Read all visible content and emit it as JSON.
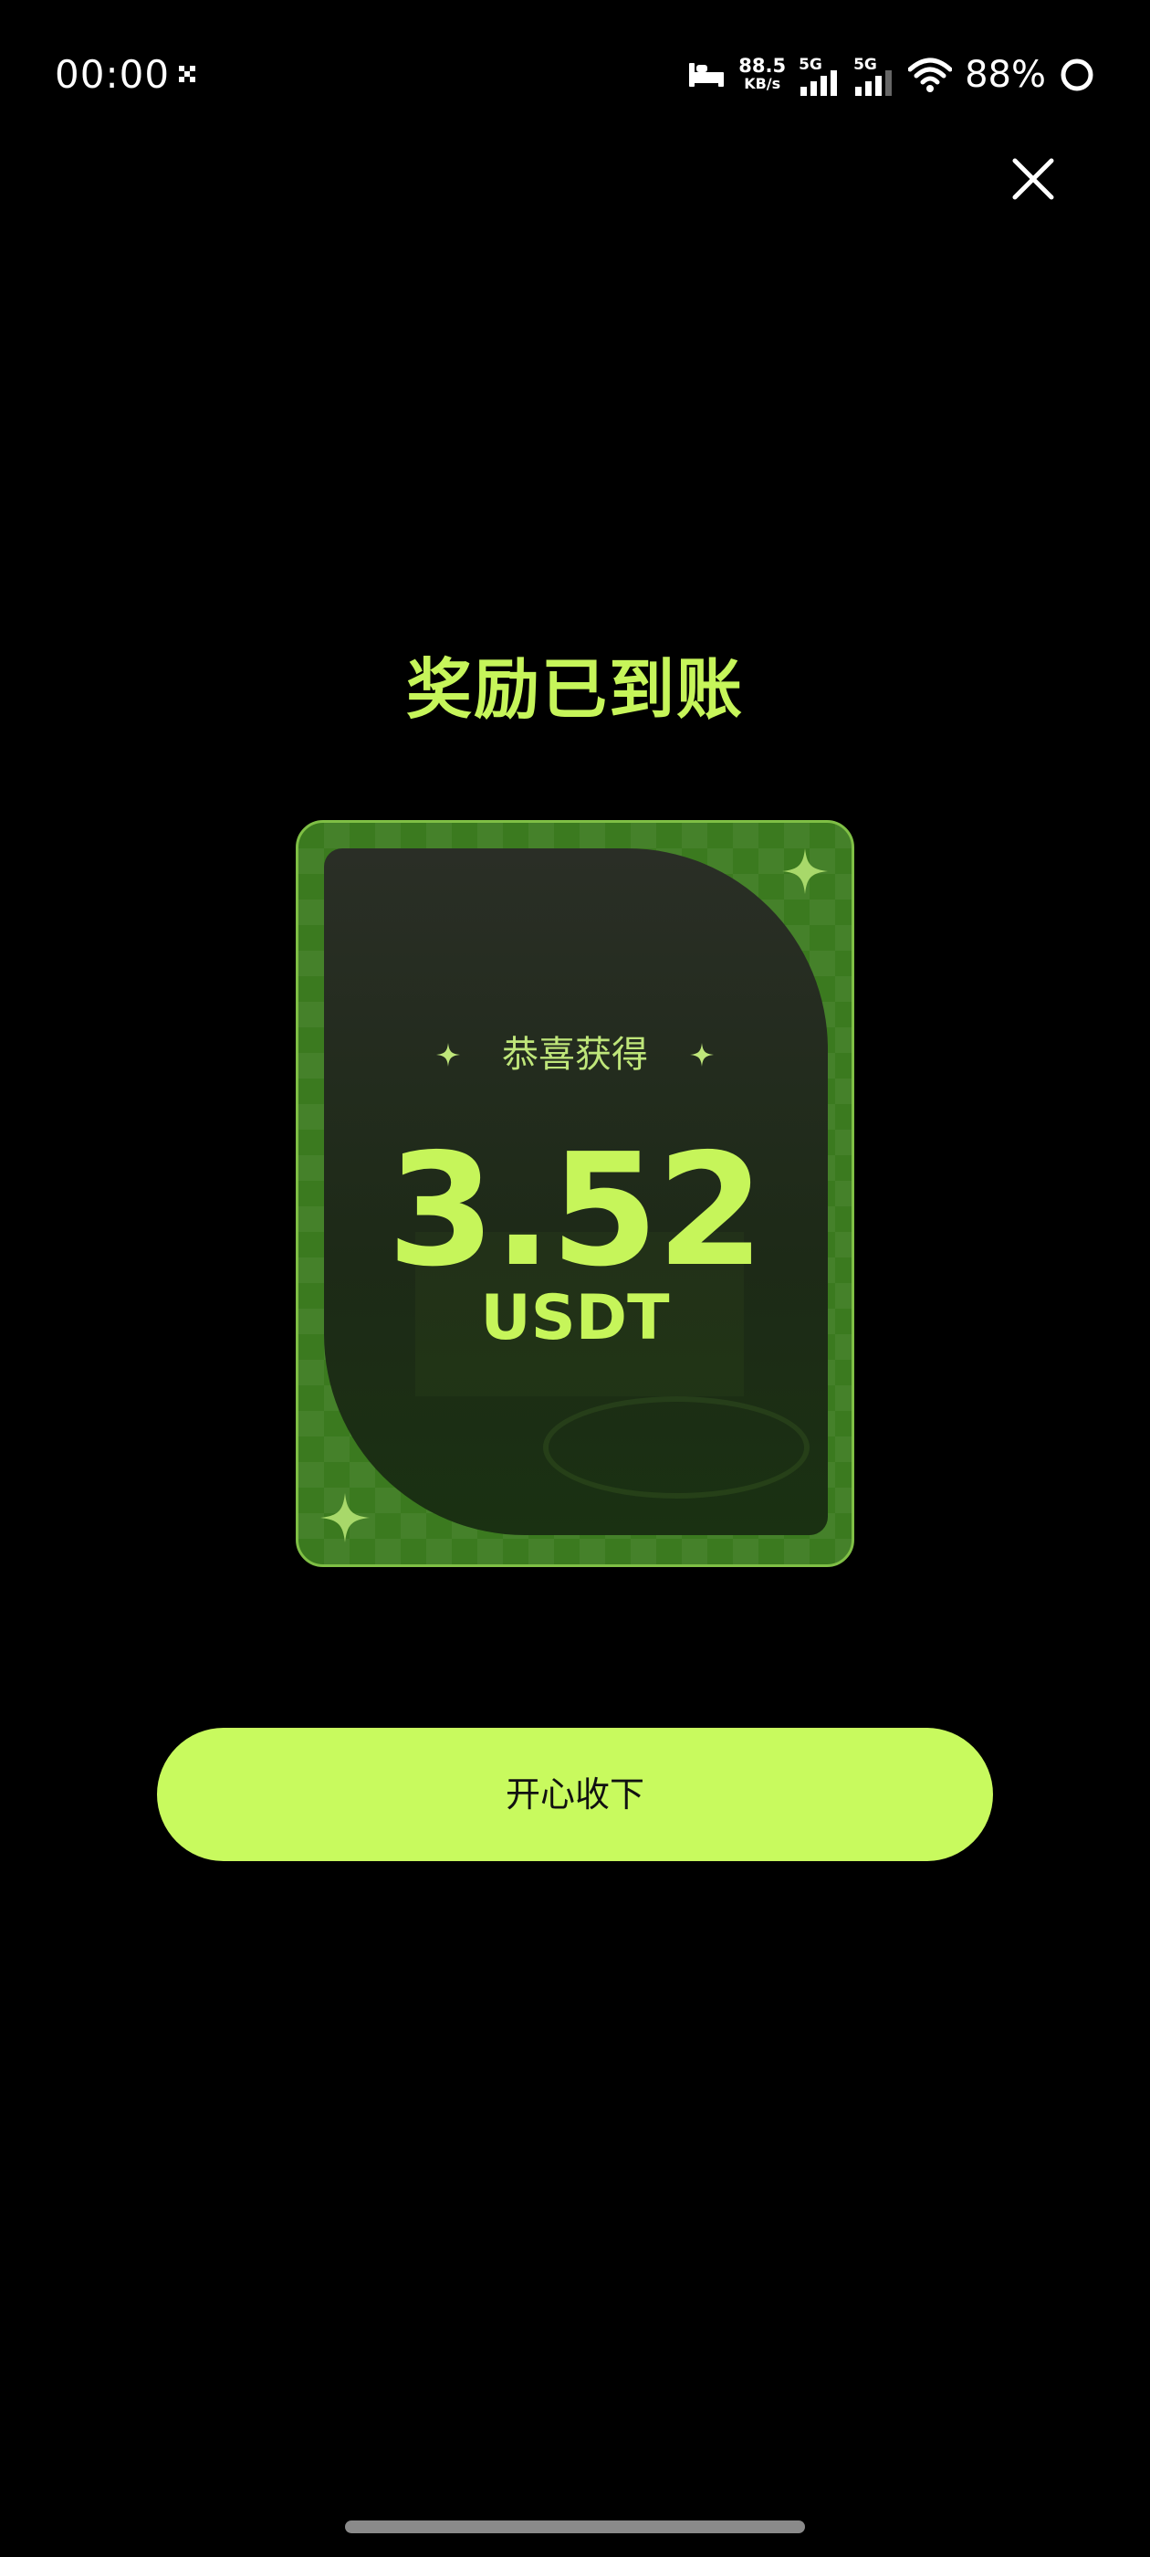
{
  "status_bar": {
    "time": "00:00",
    "net_speed_value": "88.5",
    "net_speed_unit": "KB/s",
    "signal_1_label": "5G",
    "signal_2_label": "5G",
    "battery_percent": "88%"
  },
  "reward": {
    "title": "奖励已到账",
    "subtitle": "恭喜获得",
    "amount": "3.52",
    "currency": "USDT"
  },
  "actions": {
    "accept_label": "开心收下"
  },
  "colors": {
    "accent": "#c6f55a",
    "button": "#c8fa5e",
    "card_green": "#3b7a1f",
    "background": "#000000"
  },
  "icons": {
    "close": "close-icon",
    "sparkle": "sparkle-icon",
    "wifi": "wifi-icon",
    "signal": "signal-icon",
    "bed": "bed-icon",
    "battery": "battery-ring-icon"
  }
}
